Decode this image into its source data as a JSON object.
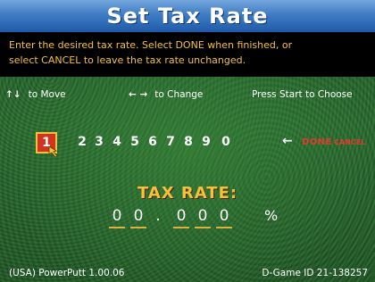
{
  "title": "Set Tax Rate",
  "instructions": {
    "line1": "Enter the desired tax rate.  Select DONE when finished, or",
    "line2": "select CANCEL to leave the tax rate unchanged."
  },
  "hints": {
    "move_arrows": "↑↓",
    "move_label": "to Move",
    "change_arrows": "← →",
    "change_label": "to Change",
    "start_label": "Press Start to Choose"
  },
  "digits": [
    "1",
    "2",
    "3",
    "4",
    "5",
    "6",
    "7",
    "8",
    "9",
    "0"
  ],
  "selected_digit": "1",
  "done_label": "DONE",
  "cancel_label": "CANCEL",
  "done_arrow": "←",
  "tax_rate": {
    "label": "TAX RATE:",
    "digits": [
      "0",
      "0",
      "0",
      "0",
      "0"
    ],
    "dot": ".",
    "percent": "%"
  },
  "footer": {
    "left": "(USA) PowerPutt 1.00.06",
    "right": "D-Game ID 21-138257"
  },
  "colors": {
    "title_bar": "#3f7cc4",
    "instruction_text": "#f2c23a",
    "accent_red": "#e53b2e",
    "grass": "#23612a"
  },
  "icons": [
    "up-down-arrow-icon",
    "left-right-arrow-icon",
    "pointer-icon",
    "left-arrow-icon"
  ]
}
